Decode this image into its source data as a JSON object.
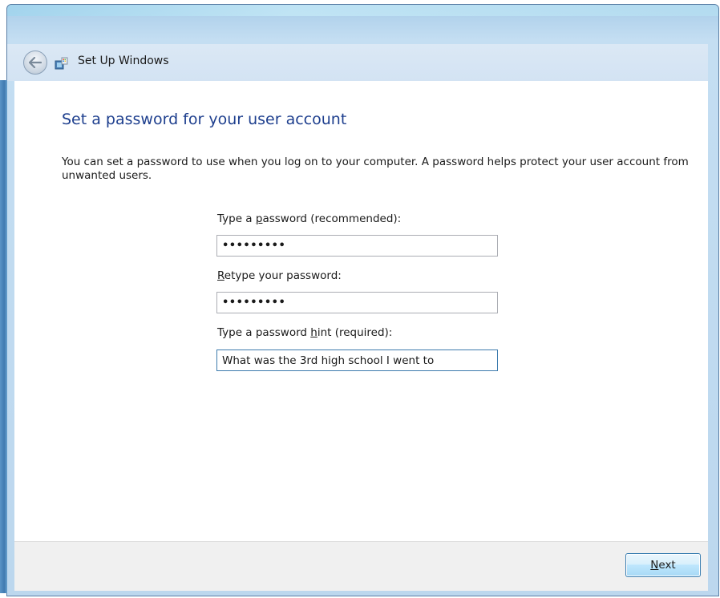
{
  "window": {
    "title": "Set Up Windows"
  },
  "page": {
    "heading": "Set a password for your user account",
    "description": "You can set a password to use when you log on to your computer. A password helps protect your user account from unwanted users."
  },
  "fields": {
    "password": {
      "label_before": "Type a ",
      "label_accel": "p",
      "label_after": "assword (recommended):",
      "value": "•••••••••"
    },
    "retype": {
      "label_before": "",
      "label_accel": "R",
      "label_after": "etype your password:",
      "value": "•••••••••"
    },
    "hint": {
      "label_before": "Type a password ",
      "label_accel": "h",
      "label_after": "int (required):",
      "value": "What was the 3rd high school I went to"
    }
  },
  "footer": {
    "next_accel": "N",
    "next_rest": "ext"
  },
  "icons": {
    "back": "back-arrow-icon",
    "setup": "setup-windows-icon"
  },
  "colors": {
    "heading": "#1e3f8e",
    "header_bg": "#d3e3f3",
    "footer_bg": "#f0f0f0",
    "button_border": "#3c7fb1"
  }
}
